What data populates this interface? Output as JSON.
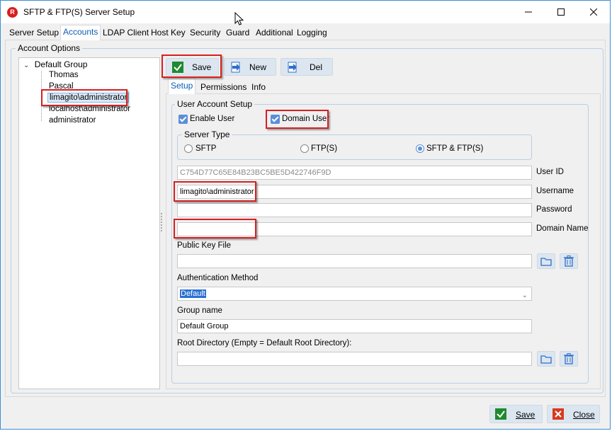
{
  "window": {
    "title": "SFTP & FTP(S) Server Setup",
    "app_icon_letter": "R"
  },
  "main_tabs": [
    "Server Setup",
    "Accounts",
    "LDAP Client",
    "Host Key",
    "Security",
    "Guard",
    "Additional",
    "Logging"
  ],
  "account_options": {
    "title": "Account Options",
    "tree": {
      "root": "Default Group",
      "children": [
        "Thomas",
        "Pascal",
        "limagito\\administrator",
        "localhost\\administrator",
        "administrator"
      ],
      "selected_index": 2
    }
  },
  "toolbar": {
    "save": "Save",
    "new": "New",
    "del": "Del"
  },
  "inner_tabs": [
    "Setup",
    "Permissions",
    "Info"
  ],
  "user_account_setup": {
    "title": "User Account Setup",
    "enable_user": {
      "label": "Enable User",
      "checked": true
    },
    "domain_user": {
      "label": "Domain User",
      "checked": true
    },
    "server_type": {
      "title": "Server Type",
      "options": [
        "SFTP",
        "FTP(S)",
        "SFTP & FTP(S)"
      ],
      "selected": "SFTP & FTP(S)"
    },
    "user_id": {
      "label": "User ID",
      "value": "C754D77C65E84B23BC5BE5D422746F9D"
    },
    "username": {
      "label": "Username",
      "value": "limagito\\administrator"
    },
    "password": {
      "label": "Password",
      "value": ""
    },
    "domain_name": {
      "label": "Domain Name",
      "value": ""
    },
    "public_key_file": {
      "label": "Public Key File",
      "value": ""
    },
    "authentication_method": {
      "label": "Authentication Method",
      "value": "Default"
    },
    "group_name": {
      "label": "Group name",
      "value": "Default Group"
    },
    "root_directory": {
      "label": "Root Directory (Empty = Default Root Directory):",
      "value": ""
    }
  },
  "footer": {
    "save": "Save",
    "close": "Close"
  },
  "colors": {
    "accent": "#0b5fb0",
    "highlight_box": "#d62020",
    "button_bg": "#dce6f0"
  }
}
